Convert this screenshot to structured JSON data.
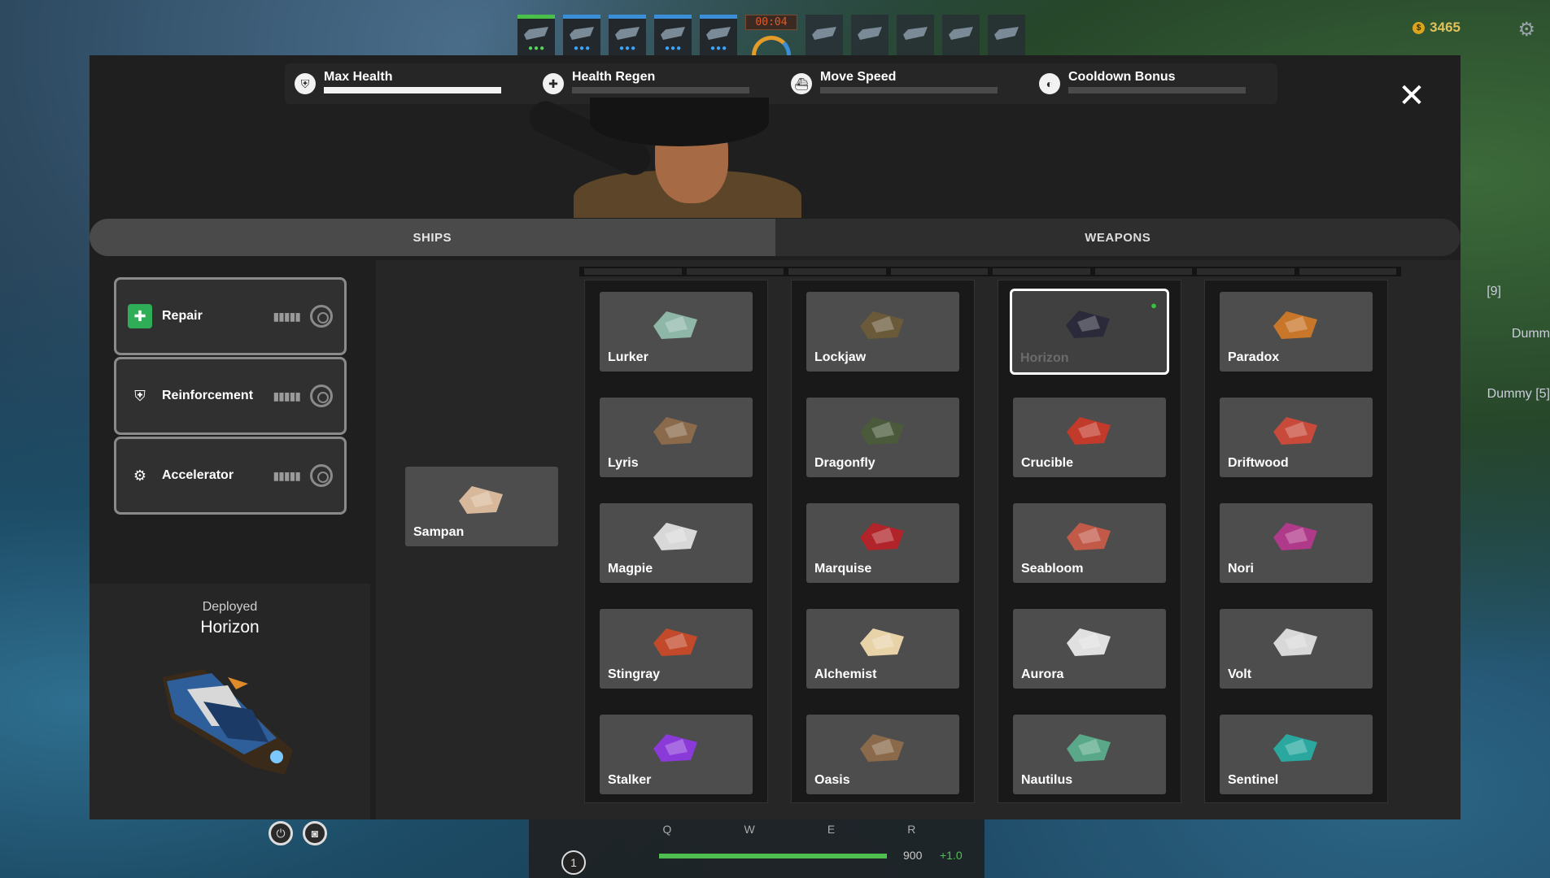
{
  "hud": {
    "timer": "00:04",
    "gold": "3465",
    "side_labels": [
      "[9]",
      "Dumm",
      "Dummy [5]"
    ]
  },
  "stats": [
    {
      "name": "Max Health",
      "icon": "shield-icon",
      "level": 1.0
    },
    {
      "name": "Health Regen",
      "icon": "shield-plus-icon",
      "level": 0.0
    },
    {
      "name": "Move Speed",
      "icon": "boat-icon",
      "level": 0.0
    },
    {
      "name": "Cooldown Bonus",
      "icon": "clock-icon",
      "level": 0.0
    }
  ],
  "tabs": {
    "ships": "SHIPS",
    "weapons": "WEAPONS"
  },
  "abilities": [
    {
      "label": "Repair",
      "icon": "repair-kit-icon",
      "color": "#2fae57"
    },
    {
      "label": "Reinforcement",
      "icon": "armor-icon",
      "color": "#303030"
    },
    {
      "label": "Accelerator",
      "icon": "engine-icon",
      "color": "#303030"
    }
  ],
  "deployed": {
    "label": "Deployed",
    "name": "Horizon"
  },
  "starter_ship": {
    "name": "Sampan"
  },
  "columns": [
    [
      "Lurker",
      "Lyris",
      "Magpie",
      "Stingray",
      "Stalker"
    ],
    [
      "Lockjaw",
      "Dragonfly",
      "Marquise",
      "Alchemist",
      "Oasis"
    ],
    [
      "Horizon",
      "Crucible",
      "Seabloom",
      "Aurora",
      "Nautilus"
    ],
    [
      "Paradox",
      "Driftwood",
      "Nori",
      "Volt",
      "Sentinel"
    ]
  ],
  "selected_ship": "Horizon",
  "ship_colors": {
    "Lurker": "#8fb7a8",
    "Lyris": "#8a6a4a",
    "Magpie": "#d8d8d8",
    "Stingray": "#c24a2a",
    "Stalker": "#8a3ad8",
    "Lockjaw": "#6a5a3a",
    "Dragonfly": "#4a5a3a",
    "Marquise": "#b0242a",
    "Alchemist": "#e8d2a8",
    "Oasis": "#8a6a4a",
    "Horizon": "#2a2a3a",
    "Crucible": "#c23a2a",
    "Seabloom": "#c25a4a",
    "Aurora": "#e0e0e0",
    "Nautilus": "#5aa88a",
    "Paradox": "#c8762a",
    "Driftwood": "#c84a3a",
    "Nori": "#b03a8a",
    "Volt": "#d8d8d8",
    "Sentinel": "#2aa8a0",
    "Sampan": "#d8b89a"
  },
  "bottom_hud": {
    "keys": [
      "Q",
      "W",
      "E",
      "R"
    ],
    "hp_value": "900",
    "hp_regen": "+1.0",
    "hp_fill": 1.0,
    "level": "1"
  }
}
